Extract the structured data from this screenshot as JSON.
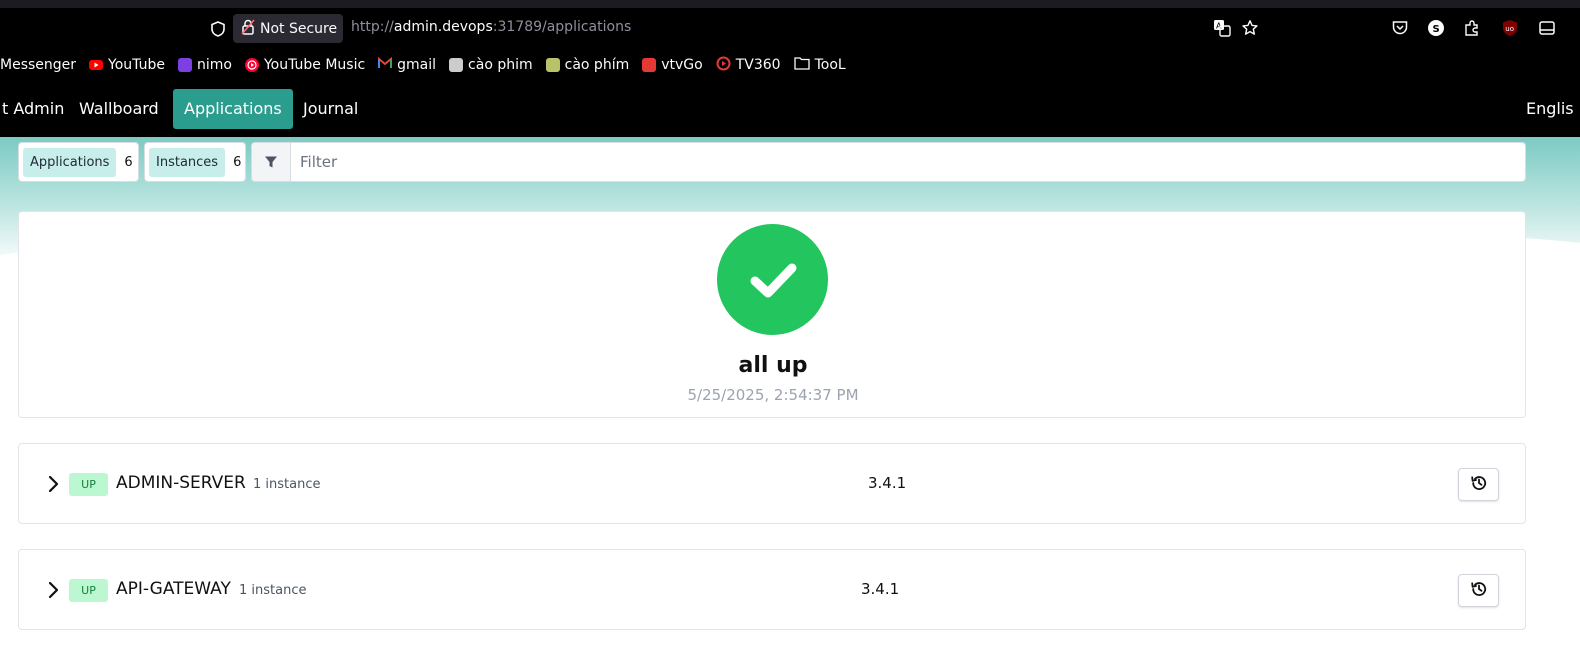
{
  "browser": {
    "security_label": "Not Secure",
    "url_prefix": "http://",
    "url_host": "admin.devops",
    "url_rest": ":31789/applications"
  },
  "bookmarks": [
    {
      "label": "Messenger",
      "icon": "none",
      "color": "#000000"
    },
    {
      "label": "YouTube",
      "icon": "youtube-icon",
      "color": "#ff0000"
    },
    {
      "label": "nimo",
      "icon": "nimo-icon",
      "color": "#7b3fe4"
    },
    {
      "label": "YouTube Music",
      "icon": "youtube-music-icon",
      "color": "#ff0033"
    },
    {
      "label": "gmail",
      "icon": "gmail-icon",
      "color": "#ea4335"
    },
    {
      "label": "cào phim",
      "icon": "page-icon",
      "color": "#cccccc"
    },
    {
      "label": "cào phím",
      "icon": "page-icon",
      "color": "#b8c26a"
    },
    {
      "label": "vtvGo",
      "icon": "vtvgo-icon",
      "color": "#e53935"
    },
    {
      "label": "TV360",
      "icon": "tv360-icon",
      "color": "#e53935"
    },
    {
      "label": "TooL",
      "icon": "folder-icon",
      "color": "#fbfbfe"
    }
  ],
  "nav": {
    "brand": "t Admin",
    "items": [
      "Wallboard",
      "Applications",
      "Journal"
    ],
    "active": "Applications",
    "language": "Englis"
  },
  "toolbar": {
    "applications_label": "Applications",
    "applications_count": "6",
    "instances_label": "Instances",
    "instances_count": "6",
    "filter_placeholder": "Filter"
  },
  "status": {
    "title": "all up",
    "timestamp": "5/25/2025, 2:54:37 PM",
    "color": "#22c55e"
  },
  "applications": [
    {
      "status": "UP",
      "name": "ADMIN-SERVER",
      "instances": "1 instance",
      "version": "3.4.1"
    },
    {
      "status": "UP",
      "name": "API-GATEWAY",
      "instances": "1 instance",
      "version": "3.4.1"
    }
  ],
  "colors": {
    "accent": "#2a9d8f",
    "up_badge_bg": "#bbf7d0",
    "up_badge_text": "#15803d"
  }
}
